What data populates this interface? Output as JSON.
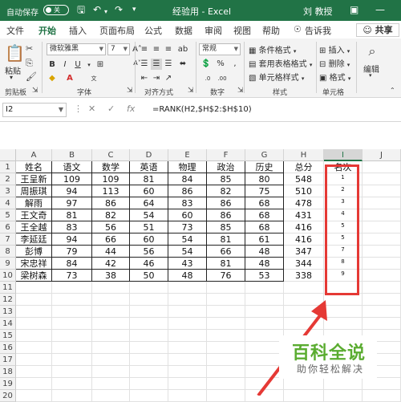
{
  "titlebar": {
    "autosave_label": "自动保存",
    "autosave_state": "关",
    "title": "经验用 - Excel",
    "user": "刘 教授"
  },
  "menu": {
    "tabs": [
      "文件",
      "开始",
      "插入",
      "页面布局",
      "公式",
      "数据",
      "审阅",
      "视图",
      "帮助"
    ],
    "active_tab": "开始",
    "tell_me": "告诉我",
    "share": "共享"
  },
  "ribbon": {
    "clipboard": {
      "paste": "粘贴",
      "label": "剪贴板"
    },
    "font": {
      "name": "微软雅黑",
      "size": "7",
      "label": "字体"
    },
    "alignment": {
      "label": "对齐方式"
    },
    "number": {
      "format": "常规",
      "label": "数字"
    },
    "styles": {
      "conditional": "条件格式",
      "table": "套用表格格式",
      "cell": "单元格样式",
      "label": "样式"
    },
    "cells": {
      "insert": "插入",
      "delete": "删除",
      "format": "格式",
      "label": "单元格"
    },
    "editing": {
      "label": "编辑"
    }
  },
  "formula_bar": {
    "name_box": "I2",
    "formula": "=RANK(H2,$H$2:$H$10)"
  },
  "sheet": {
    "columns": [
      "A",
      "B",
      "C",
      "D",
      "E",
      "F",
      "G",
      "H",
      "I",
      "J"
    ],
    "rows": [
      "1",
      "2",
      "3",
      "4",
      "5",
      "6",
      "7",
      "8",
      "9",
      "10",
      "11",
      "12",
      "13",
      "14",
      "15",
      "16",
      "17",
      "18",
      "19",
      "20"
    ],
    "header": [
      "姓名",
      "语文",
      "数学",
      "英语",
      "物理",
      "政治",
      "历史",
      "总分",
      "名次"
    ],
    "data": [
      [
        "王呈新",
        "109",
        "109",
        "81",
        "84",
        "85",
        "80",
        "548",
        "1"
      ],
      [
        "周振琪",
        "94",
        "113",
        "60",
        "86",
        "82",
        "75",
        "510",
        "2"
      ],
      [
        "解雨",
        "97",
        "86",
        "64",
        "83",
        "86",
        "68",
        "478",
        "3"
      ],
      [
        "王文奇",
        "81",
        "82",
        "54",
        "60",
        "86",
        "68",
        "431",
        "4"
      ],
      [
        "王全越",
        "83",
        "56",
        "51",
        "73",
        "85",
        "68",
        "416",
        "5"
      ],
      [
        "李延廷",
        "94",
        "66",
        "60",
        "54",
        "81",
        "61",
        "416",
        "5"
      ],
      [
        "彭博",
        "79",
        "44",
        "56",
        "54",
        "66",
        "48",
        "347",
        "7"
      ],
      [
        "宋忠祥",
        "84",
        "42",
        "46",
        "43",
        "81",
        "48",
        "344",
        "8"
      ],
      [
        "梁树森",
        "73",
        "38",
        "50",
        "48",
        "76",
        "53",
        "338",
        "9"
      ]
    ]
  },
  "watermark": {
    "title": "百科全说",
    "subtitle": "助你轻松解决"
  }
}
